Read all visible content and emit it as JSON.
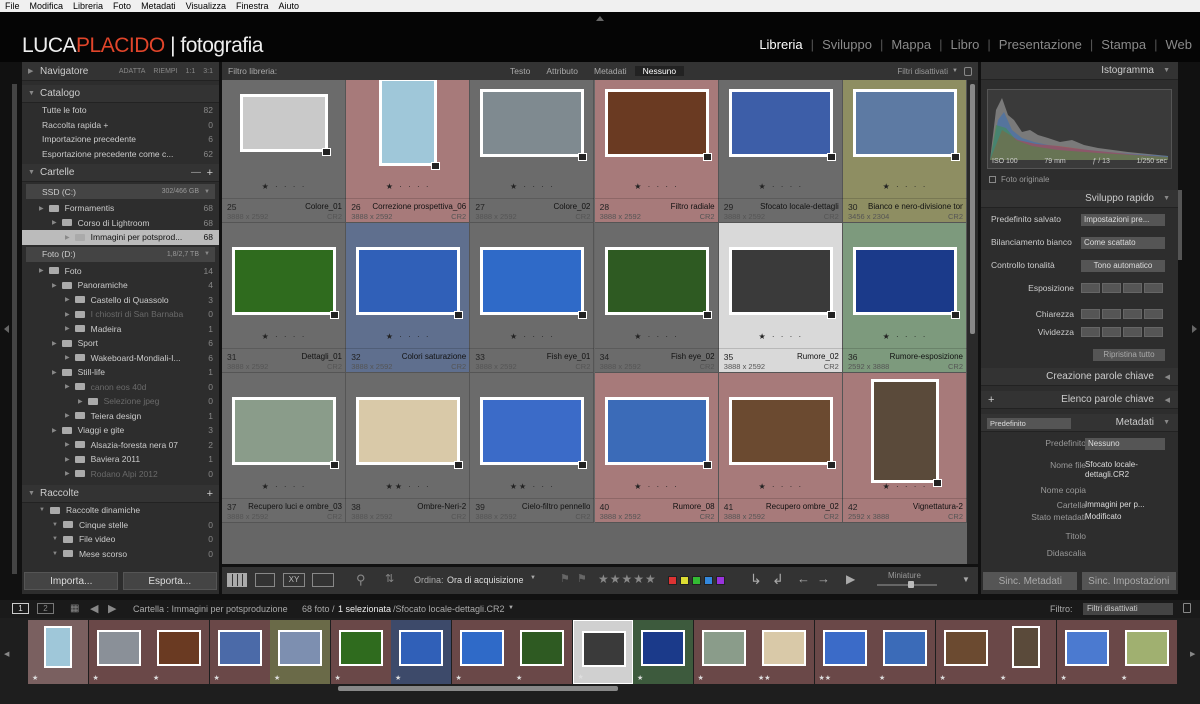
{
  "menu": [
    "File",
    "Modifica",
    "Libreria",
    "Foto",
    "Metadati",
    "Visualizza",
    "Finestra",
    "Aiuto"
  ],
  "logo": {
    "part1": "LUCA",
    "part2": "PLACIDO",
    "part3": "| fotografia"
  },
  "modules": [
    "Libreria",
    "Sviluppo",
    "Mappa",
    "Libro",
    "Presentazione",
    "Stampa",
    "Web"
  ],
  "active_module": "Libreria",
  "left": {
    "navigator": {
      "title": "Navigatore",
      "opts": [
        "ADATTA",
        "RIEMPI",
        "1:1",
        "3:1"
      ]
    },
    "catalog": {
      "title": "Catalogo",
      "items": [
        {
          "label": "Tutte le foto",
          "count": "82"
        },
        {
          "label": "Raccolta rapida +",
          "count": "0"
        },
        {
          "label": "Importazione precedente",
          "count": "6"
        },
        {
          "label": "Esportazione precedente come c...",
          "count": "62"
        }
      ]
    },
    "folders": {
      "title": "Cartelle",
      "plus": "+",
      "drive1": {
        "label": "SSD (C:)",
        "size": "302/466 GB"
      },
      "drive1_items": [
        {
          "label": "Formamentis",
          "count": "68",
          "indent": 1,
          "dim": false,
          "sel": false
        },
        {
          "label": "Corso di Lightroom",
          "count": "68",
          "indent": 2,
          "dim": false,
          "sel": false
        },
        {
          "label": "Immagini per potsprod...",
          "count": "68",
          "indent": 3,
          "dim": false,
          "sel": true
        }
      ],
      "drive2": {
        "label": "Foto (D:)",
        "size": "1,8/2,7 TB"
      },
      "drive2_items": [
        {
          "label": "Foto",
          "count": "14",
          "indent": 1,
          "dim": false,
          "sel": false
        },
        {
          "label": "Panoramiche",
          "count": "4",
          "indent": 2,
          "dim": false,
          "sel": false
        },
        {
          "label": "Castello di Quassolo",
          "count": "3",
          "indent": 3,
          "dim": false,
          "sel": false
        },
        {
          "label": "I chiostri di San Barnaba",
          "count": "0",
          "indent": 3,
          "dim": true,
          "sel": false
        },
        {
          "label": "Madeira",
          "count": "1",
          "indent": 3,
          "dim": false,
          "sel": false
        },
        {
          "label": "Sport",
          "count": "6",
          "indent": 2,
          "dim": false,
          "sel": false
        },
        {
          "label": "Wakeboard-Mondiali-I...",
          "count": "6",
          "indent": 3,
          "dim": false,
          "sel": false
        },
        {
          "label": "Still-life",
          "count": "1",
          "indent": 2,
          "dim": false,
          "sel": false
        },
        {
          "label": "canon eos 40d",
          "count": "0",
          "indent": 3,
          "dim": true,
          "sel": false
        },
        {
          "label": "Selezione jpeg",
          "count": "0",
          "indent": 4,
          "dim": true,
          "sel": false
        },
        {
          "label": "Teiera design",
          "count": "1",
          "indent": 3,
          "dim": false,
          "sel": false
        },
        {
          "label": "Viaggi e gite",
          "count": "3",
          "indent": 2,
          "dim": false,
          "sel": false
        },
        {
          "label": "Alsazia-foresta nera 07",
          "count": "2",
          "indent": 3,
          "dim": false,
          "sel": false
        },
        {
          "label": "Baviera 2011",
          "count": "1",
          "indent": 3,
          "dim": false,
          "sel": false
        },
        {
          "label": "Rodano Alpi 2012",
          "count": "0",
          "indent": 3,
          "dim": true,
          "sel": false
        }
      ]
    },
    "collections": {
      "title": "Raccolte",
      "plus": "+",
      "items": [
        {
          "label": "Raccolte dinamiche",
          "count": "",
          "indent": 1
        },
        {
          "label": "Cinque stelle",
          "count": "0",
          "indent": 2
        },
        {
          "label": "File video",
          "count": "0",
          "indent": 2
        },
        {
          "label": "Mese scorso",
          "count": "0",
          "indent": 2
        }
      ]
    },
    "import_btn": "Importa...",
    "export_btn": "Esporta..."
  },
  "filterbar": {
    "label": "Filtro libreria:",
    "tabs": [
      "Testo",
      "Attributo",
      "Metadati",
      "Nessuno"
    ],
    "active": "Nessuno",
    "presets": "Filtri disattivati"
  },
  "grid": [
    {
      "num": "25",
      "name": "Colore_01",
      "dim": "3888 x 2592",
      "ext": "CR2",
      "stars": "★ · · · ·",
      "bg": "#6b6b6b",
      "tw": 88,
      "th": 58,
      "tc": "#c9c9c9"
    },
    {
      "num": "26",
      "name": "Correzione prospettiva_06",
      "dim": "3888 x 2592",
      "ext": "CR2",
      "stars": "★ · · · ·",
      "bg": "#a77a7a",
      "tw": 58,
      "th": 88,
      "tc": "#9fc7d9"
    },
    {
      "num": "27",
      "name": "Colore_02",
      "dim": "3888 x 2592",
      "ext": "CR2",
      "stars": "★ · · · ·",
      "bg": "#6b6b6b",
      "tw": 104,
      "th": 68,
      "tc": "#7f8a90"
    },
    {
      "num": "28",
      "name": "Filtro radiale",
      "dim": "3888 x 2592",
      "ext": "CR2",
      "stars": "★ · · · ·",
      "bg": "#a77a7a",
      "tw": 104,
      "th": 68,
      "tc": "#6a3a22"
    },
    {
      "num": "29",
      "name": "Sfocato locale-dettagli",
      "dim": "3888 x 2592",
      "ext": "CR2",
      "stars": "★ · · · ·",
      "bg": "#6b6b6b",
      "tw": 104,
      "th": 68,
      "tc": "#3d5ea8"
    },
    {
      "num": "30",
      "name": "Bianco e nero-divisione toni",
      "dim": "3456 x 2304",
      "ext": "CR2",
      "stars": "★ · · · ·",
      "bg": "#8e8e62",
      "tw": 104,
      "th": 68,
      "tc": "#5d7aa3"
    },
    {
      "num": "31",
      "name": "Dettagli_01",
      "dim": "3888 x 2592",
      "ext": "CR2",
      "stars": "★ · · · ·",
      "bg": "#6b6b6b",
      "tw": 104,
      "th": 68,
      "tc": "#2f6b1e"
    },
    {
      "num": "32",
      "name": "Colori saturazione",
      "dim": "3888 x 2592",
      "ext": "CR2",
      "stars": "★ · · · ·",
      "bg": "#5f6f8e",
      "tw": 104,
      "th": 68,
      "tc": "#3060b8"
    },
    {
      "num": "33",
      "name": "Fish eye_01",
      "dim": "3888 x 2592",
      "ext": "CR2",
      "stars": "★ · · · ·",
      "bg": "#6b6b6b",
      "tw": 104,
      "th": 68,
      "tc": "#2f6ac8"
    },
    {
      "num": "34",
      "name": "Fish eye_02",
      "dim": "3888 x 2592",
      "ext": "CR2",
      "stars": "★ · · · ·",
      "bg": "#6b6b6b",
      "tw": 104,
      "th": 68,
      "tc": "#2e5a22"
    },
    {
      "num": "35",
      "name": "Rumore_02",
      "dim": "3888 x 2592",
      "ext": "CR2",
      "stars": "★ · · · ·",
      "bg": "#d9d9d9",
      "tw": 104,
      "th": 68,
      "tc": "#3a3a3a"
    },
    {
      "num": "36",
      "name": "Rumore-esposizione",
      "dim": "2592 x 3888",
      "ext": "CR2",
      "stars": "★ · · · ·",
      "bg": "#7d9a7d",
      "tw": 104,
      "th": 68,
      "tc": "#1b3a8a"
    },
    {
      "num": "37",
      "name": "Recupero luci e ombre_03",
      "dim": "3888 x 2592",
      "ext": "CR2",
      "stars": "★ · · · ·",
      "bg": "#6b6b6b",
      "tw": 104,
      "th": 68,
      "tc": "#8a9c8a"
    },
    {
      "num": "38",
      "name": "Ombre-Neri-2",
      "dim": "3888 x 2592",
      "ext": "CR2",
      "stars": "★★ · · ·",
      "bg": "#6b6b6b",
      "tw": 104,
      "th": 68,
      "tc": "#d9c9a8"
    },
    {
      "num": "39",
      "name": "Cielo-filtro pennello",
      "dim": "3888 x 2592",
      "ext": "CR2",
      "stars": "★★ · · ·",
      "bg": "#6b6b6b",
      "tw": 104,
      "th": 68,
      "tc": "#3b6bc8"
    },
    {
      "num": "40",
      "name": "Rumore_08",
      "dim": "3888 x 2592",
      "ext": "CR2",
      "stars": "★ · · · ·",
      "bg": "#a77a7a",
      "tw": 104,
      "th": 68,
      "tc": "#3b6bb8"
    },
    {
      "num": "41",
      "name": "Recupero ombre_02",
      "dim": "3888 x 2592",
      "ext": "CR2",
      "stars": "★ · · · ·",
      "bg": "#a77a7a",
      "tw": 104,
      "th": 68,
      "tc": "#6b4a30"
    },
    {
      "num": "42",
      "name": "Vignettatura-2",
      "dim": "2592 x 3888",
      "ext": "CR2",
      "stars": "★ · · · ·",
      "bg": "#a77a7a",
      "tw": 68,
      "th": 104,
      "tc": "#5a4a3a"
    }
  ],
  "toolbar": {
    "sort_label": "Ordina:",
    "sort_value": "Ora di acquisizione",
    "thumbs_label": "Miniature",
    "flag_colors": [
      "#d33",
      "#dd3",
      "#3b3",
      "#38d",
      "#93d"
    ]
  },
  "right": {
    "histogram": {
      "title": "Istogramma",
      "iso": "ISO 100",
      "focal": "79 mm",
      "aperture": "ƒ / 13",
      "shutter": "1/250 sec",
      "original": "Foto originale"
    },
    "quick_develop": {
      "title": "Sviluppo rapido",
      "preset_label": "Predefinito salvato",
      "preset_value": "Impostazioni pre...",
      "wb_label": "Bilanciamento bianco",
      "wb_value": "Come scattato",
      "tone_label": "Controllo tonalità",
      "tone_value": "Tono automatico",
      "exposure": "Esposizione",
      "clarity": "Chiarezza",
      "vibrance": "Vividezza",
      "reset": "Ripristina tutto"
    },
    "keywording": {
      "title": "Creazione parole chiave"
    },
    "keyword_list": {
      "title": "Elenco parole chiave",
      "plus": "+"
    },
    "metadata": {
      "title": "Metadati",
      "preset_sel": "Predefinito",
      "rows": [
        {
          "label": "Predefinito",
          "value": "Nessuno"
        },
        {
          "label": "Nome file",
          "value": "Sfocato locale-dettagli.CR2"
        },
        {
          "label": "Nome copia",
          "value": ""
        },
        {
          "label": "Cartella",
          "value": "Immagini per p..."
        },
        {
          "label": "Stato metadati",
          "value": "Modificato"
        },
        {
          "label": "Titolo",
          "value": ""
        },
        {
          "label": "Didascalia",
          "value": ""
        }
      ]
    },
    "sync_meta": "Sinc. Metadati",
    "sync_settings": "Sinc. Impostazioni"
  },
  "status": {
    "page1": "1",
    "page2": "2",
    "path": "Cartella : Immagini per potsproduzione",
    "count_pre": "68 foto /",
    "count_sel": "1 selezionata",
    "file": "/Sfocato locale-dettagli.CR2",
    "filter_label": "Filtro:",
    "filter_value": "Filtri disattivati"
  },
  "filmstrip": [
    {
      "bg": "#7a6060",
      "tc": "#9fc7d9",
      "stars": "★"
    },
    {
      "bg": "#6a4848",
      "tc": "#8a9098",
      "stars": "★"
    },
    {
      "bg": "#6a4848",
      "tc": "#6a3a22",
      "stars": "★"
    },
    {
      "bg": "#6a4848",
      "tc": "#4b6aa8",
      "stars": "★"
    },
    {
      "bg": "#6a6a48",
      "tc": "#7d8fb0",
      "stars": "★"
    },
    {
      "bg": "#6a4848",
      "tc": "#2f6b1e",
      "stars": "★"
    },
    {
      "bg": "#3d4a6a",
      "tc": "#3060b8",
      "stars": "★"
    },
    {
      "bg": "#6a4848",
      "tc": "#2f6ac8",
      "stars": "★"
    },
    {
      "bg": "#6a4848",
      "tc": "#2e5a22",
      "stars": "★"
    },
    {
      "bg": "#d0d0d0",
      "tc": "#3a3a3a",
      "stars": "★"
    },
    {
      "bg": "#3d5a3d",
      "tc": "#1b3a8a",
      "stars": "★"
    },
    {
      "bg": "#6a4848",
      "tc": "#8a9c8a",
      "stars": "★"
    },
    {
      "bg": "#6a4848",
      "tc": "#d9c9a8",
      "stars": "★★"
    },
    {
      "bg": "#6a4848",
      "tc": "#3b6bc8",
      "stars": "★★"
    },
    {
      "bg": "#6a4848",
      "tc": "#3b6bb8",
      "stars": "★"
    },
    {
      "bg": "#6a4848",
      "tc": "#6b4a30",
      "stars": "★"
    },
    {
      "bg": "#6a4848",
      "tc": "#5a4a3a",
      "stars": "★"
    },
    {
      "bg": "#6a4848",
      "tc": "#4b7ad0",
      "stars": "★"
    },
    {
      "bg": "#6a4848",
      "tc": "#a0b070",
      "stars": "★"
    }
  ]
}
